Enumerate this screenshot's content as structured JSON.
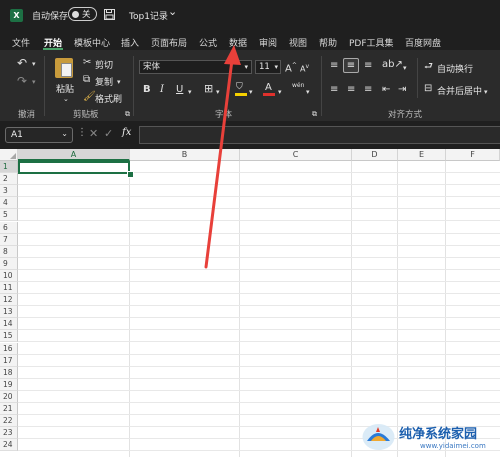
{
  "title_bar": {
    "app_icon_letter": "X",
    "autosave_label": "自动保存",
    "autosave_state": "关",
    "save_icon": "save-icon",
    "file_name": "Top1记录",
    "file_chevron": "⌄"
  },
  "menu": {
    "tabs": [
      "文件",
      "开始",
      "模板中心",
      "插入",
      "页面布局",
      "公式",
      "数据",
      "审阅",
      "视图",
      "帮助",
      "PDF工具集",
      "百度网盘"
    ],
    "active_index": 1
  },
  "ribbon": {
    "undo_group": {
      "label": "撤消"
    },
    "clipboard": {
      "label": "剪贴板",
      "paste": "粘贴",
      "cut": "剪切",
      "copy": "复制",
      "format_painter": "格式刷"
    },
    "font": {
      "label": "字体",
      "font_name": "宋体",
      "font_size": "11",
      "bold": "B",
      "italic": "I",
      "underline": "U",
      "grow": "A",
      "shrink": "A",
      "font_color_letter": "A",
      "abc_label": "wén"
    },
    "alignment": {
      "label": "对齐方式",
      "wrap_text": "自动换行",
      "merge_center": "合并后居中"
    }
  },
  "formula_bar": {
    "name_box": "A1",
    "fx": "fx",
    "content": ""
  },
  "sheet": {
    "columns": [
      {
        "id": "corner",
        "label": ""
      },
      {
        "id": "A",
        "label": "A"
      },
      {
        "id": "B",
        "label": "B"
      },
      {
        "id": "C",
        "label": "C"
      },
      {
        "id": "D",
        "label": "D"
      },
      {
        "id": "E",
        "label": "E"
      },
      {
        "id": "F",
        "label": "F"
      }
    ],
    "rows": [
      "1",
      "2",
      "3",
      "4",
      "5",
      "6",
      "7",
      "8",
      "9",
      "10",
      "11",
      "12",
      "13",
      "14",
      "15",
      "16",
      "17",
      "18",
      "19",
      "20",
      "21",
      "22",
      "23",
      "24"
    ],
    "selected_cell": "A1"
  },
  "annotation": {
    "arrow_color": "#e8403a",
    "points_to": "数据"
  },
  "watermark": {
    "text": "纯净系统家园",
    "url": "www.yidaimei.com"
  },
  "colors": {
    "accent_green": "#1d7044",
    "title_bg": "#1f1f1f",
    "ribbon_bg": "#2b2b2b",
    "highlight_yellow": "#f5d000",
    "font_red": "#e0312c"
  }
}
